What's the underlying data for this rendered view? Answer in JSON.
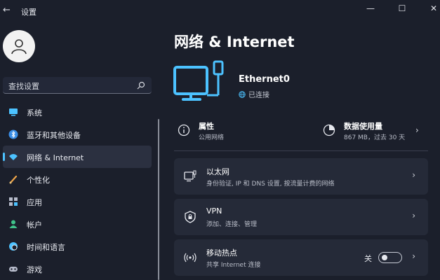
{
  "window": {
    "title": "设置",
    "back_glyph": "←",
    "minimize_glyph": "—",
    "maximize_glyph": "☐",
    "close_glyph": "✕"
  },
  "search": {
    "placeholder": "查找设置"
  },
  "sidebar": {
    "items": [
      {
        "label": "系统",
        "icon": "system-display-icon",
        "active": false
      },
      {
        "label": "蓝牙和其他设备",
        "icon": "bluetooth-icon",
        "active": false
      },
      {
        "label": "网络 & Internet",
        "icon": "wifi-icon",
        "active": true
      },
      {
        "label": "个性化",
        "icon": "paintbrush-icon",
        "active": false
      },
      {
        "label": "应用",
        "icon": "apps-icon",
        "active": false
      },
      {
        "label": "帐户",
        "icon": "account-icon",
        "active": false
      },
      {
        "label": "时间和语言",
        "icon": "clock-globe-icon",
        "active": false
      },
      {
        "label": "游戏",
        "icon": "gamepad-icon",
        "active": false
      }
    ]
  },
  "main": {
    "title": "网络 & Internet",
    "connection": {
      "name": "Ethernet0",
      "status": "已连接"
    },
    "properties": {
      "title": "属性",
      "subtitle": "公用网络"
    },
    "data_usage": {
      "title": "数据使用量",
      "subtitle": "867 MB，过去 30 天"
    },
    "cards": [
      {
        "title": "以太网",
        "subtitle": "身份验证, IP 和 DNS 设置, 按流量计费的网络",
        "icon": "ethernet-monitor-icon"
      },
      {
        "title": "VPN",
        "subtitle": "添加、连接、管理",
        "icon": "vpn-shield-icon"
      },
      {
        "title": "移动热点",
        "subtitle": "共享 Internet 连接",
        "icon": "hotspot-icon",
        "toggle_label": "关",
        "toggle_on": false
      }
    ],
    "chevron": "›"
  },
  "colors": {
    "accent": "#4cc2ff",
    "background": "#1b1f2b",
    "card": "#252a38"
  }
}
